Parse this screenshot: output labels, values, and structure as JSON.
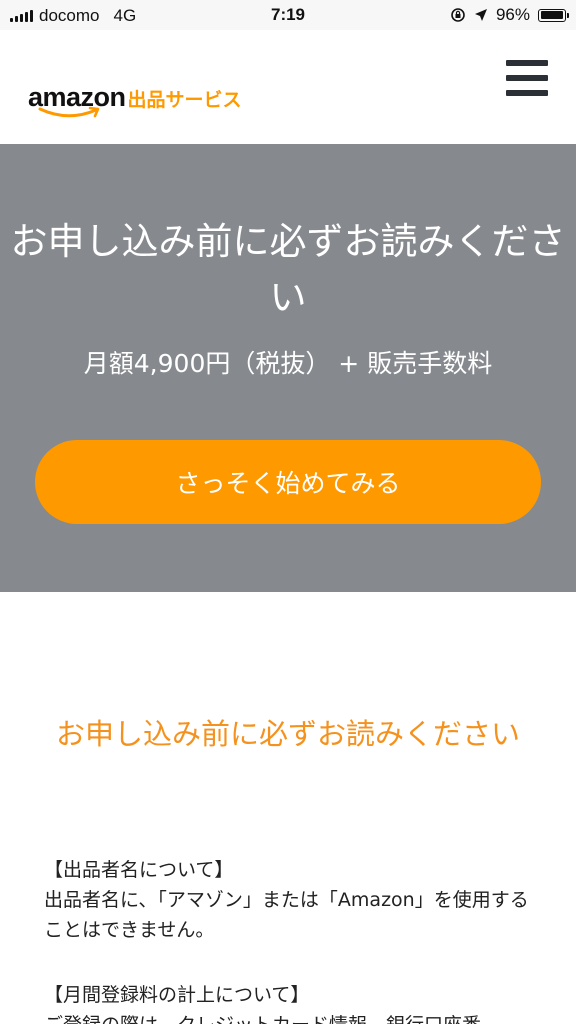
{
  "status_bar": {
    "carrier": "docomo",
    "network": "4G",
    "time": "7:19",
    "battery": "96%",
    "battery_level": 0.96
  },
  "header": {
    "logo_word": "amazon",
    "logo_sub": "出品サービス"
  },
  "hero": {
    "title": "お申し込み前に必ずお読みください",
    "price": "月額4,900円（税抜） + 販売手数料",
    "cta_label": "さっそく始めてみる"
  },
  "main": {
    "section_title": "お申し込み前に必ずお読みください",
    "notices": [
      {
        "heading": "【出品者名について】",
        "body": "出品者名に、「アマゾン」または「Amazon」を使用することはできません。"
      },
      {
        "heading": "【月間登録料の計上について】",
        "body": "ご登録の際は、クレジットカード情報、銀行口座番"
      }
    ]
  },
  "colors": {
    "brand_orange": "#ff9900",
    "hero_bg": "#868a8f",
    "section_title": "#f5921e"
  }
}
